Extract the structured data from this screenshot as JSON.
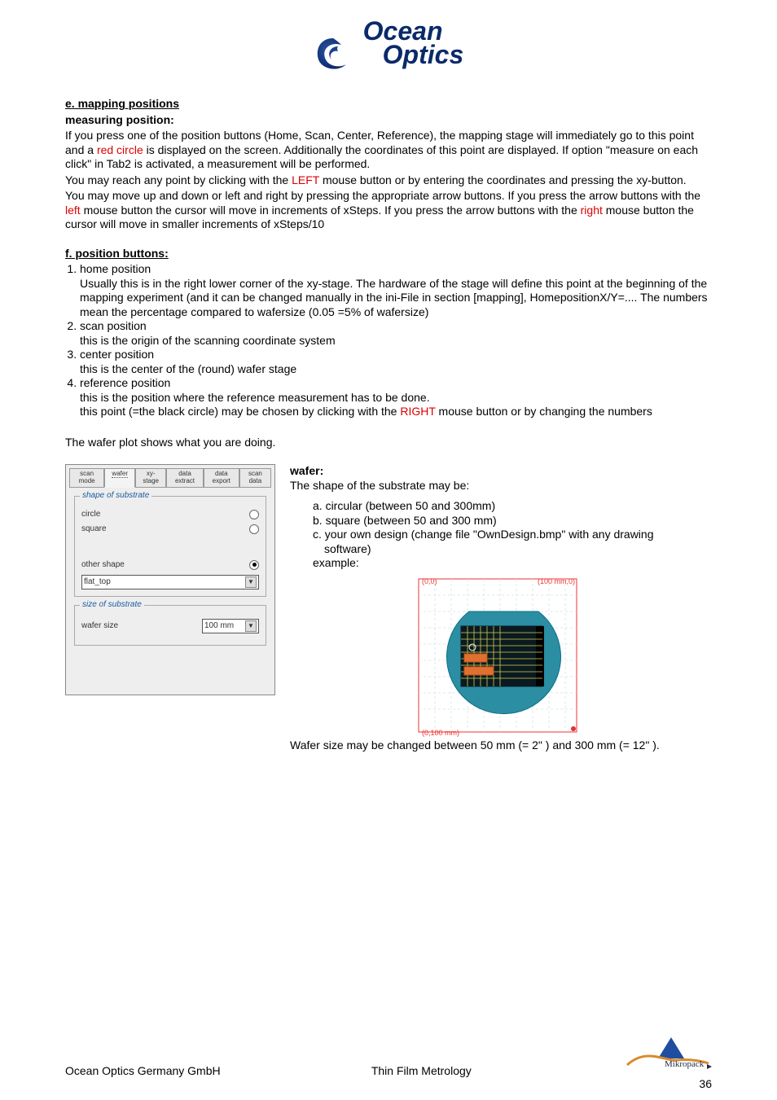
{
  "logo": {
    "line1": "Ocean",
    "line2": "Optics"
  },
  "section_e": {
    "heading": "e. mapping positions",
    "subheading": "measuring position:",
    "p1a": "If you press one of the position buttons (Home, Scan, Center, Reference), the mapping stage will immediately go to this point and a ",
    "p1_red1": "red circle",
    "p1b": " is displayed on the screen. Additionally the coordinates of this point are displayed. If option \"measure on each click\" in Tab2 is activated, a measurement will be performed.",
    "p2a": "You may reach any point by clicking with the ",
    "p2_red": "LEFT",
    "p2b": " mouse button or by entering the coordinates and pressing the xy-button.",
    "p3a": "You may move up and down or left and right by pressing the appropriate arrow buttons. If you press the arrow buttons with the ",
    "p3_red1": "left",
    "p3b": " mouse button the cursor will move in increments of xSteps. If you press the arrow buttons with the ",
    "p3_red2": "right",
    "p3c": " mouse button the cursor will move in smaller increments of xSteps/10"
  },
  "section_f": {
    "heading": "f. position buttons:",
    "items": [
      {
        "title": "home position",
        "body": "Usually this is in the right lower corner of the xy-stage. The hardware of the stage will define this point at the beginning of the mapping experiment (and it can be changed manually in the ini-File in section [mapping], HomepositionX/Y=.... The numbers mean the percentage compared to wafersize (0.05 =5% of wafersize)"
      },
      {
        "title": "scan position",
        "body": "this is the origin of the scanning coordinate system"
      },
      {
        "title": "center position",
        "body": "this is the center of the (round) wafer stage"
      },
      {
        "title": "reference position",
        "body_a": "this is the position where the reference measurement has to be done.",
        "body_b_pre": "this point  (=the black circle) may be chosen by clicking with the ",
        "body_b_red": "RIGHT",
        "body_b_post": " mouse button or by changing the numbers"
      }
    ],
    "afterlist": "The wafer plot shows what you are doing."
  },
  "panel": {
    "tabs": [
      "scan mode",
      "wafer",
      "xy-stage",
      "data extract",
      "data export",
      "scan data"
    ],
    "active_tab": 1,
    "group1": {
      "legend": "shape of substrate",
      "opts": [
        "circle",
        "square",
        "other shape"
      ],
      "selected": 2,
      "dropdown": "flat_top"
    },
    "group2": {
      "legend": "size of substrate",
      "label": "wafer size",
      "dropdown": "100 mm"
    }
  },
  "wafer": {
    "heading": "wafer:",
    "intro": "The shape of the substrate may be:",
    "a": "a. circular (between 50 and 300mm)",
    "b": "b. square (between 50 and 300 mm)",
    "c1": "c. your own design (change file \"OwnDesign.bmp\" with any drawing",
    "c2": "software)",
    "example": "example:",
    "overlay": {
      "tl": "(0,0)",
      "tr": "(100 mm,0)",
      "bl": "(0,100 mm)"
    },
    "closing": "Wafer size may be changed between 50 mm (= 2\" ) and 300 mm (= 12\" )."
  },
  "footer": {
    "left": "Ocean Optics Germany GmbH",
    "center": "Thin Film Metrology",
    "brand": "Mikropack",
    "page": "36"
  }
}
